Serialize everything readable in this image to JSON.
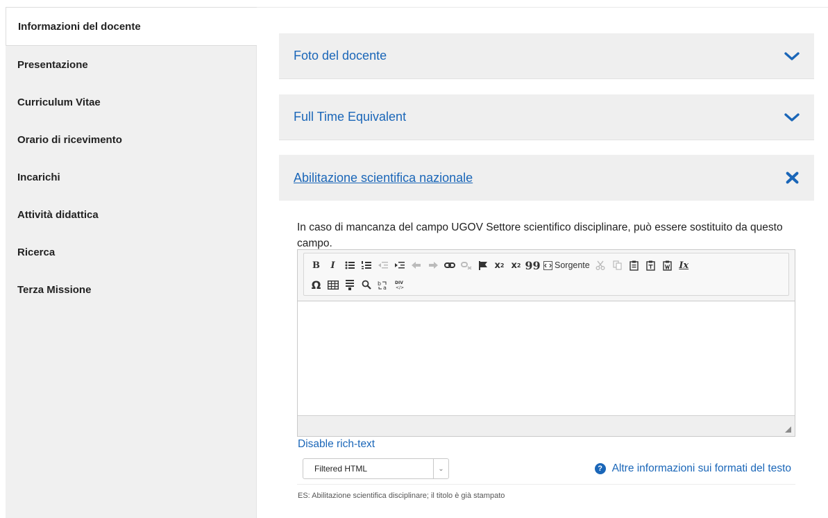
{
  "sidebar": {
    "items": [
      {
        "label": "Informazioni del docente",
        "active": true
      },
      {
        "label": "Presentazione"
      },
      {
        "label": "Curriculum Vitae"
      },
      {
        "label": "Orario di ricevimento"
      },
      {
        "label": "Incarichi"
      },
      {
        "label": "Attività didattica"
      },
      {
        "label": "Ricerca"
      },
      {
        "label": "Terza Missione"
      }
    ]
  },
  "panels": [
    {
      "title": "Foto del docente",
      "state": "collapsed",
      "icon": "chevron-down-icon"
    },
    {
      "title": "Full Time Equivalent",
      "state": "collapsed",
      "icon": "chevron-down-icon"
    },
    {
      "title": "Abilitazione scientifica nazionale",
      "state": "expanded",
      "icon": "close-icon"
    }
  ],
  "editor": {
    "help_text": "In caso di mancanza del campo UGOV Settore scientifico disciplinare, può essere sostituito da questo campo.",
    "toolbar": {
      "bold": "B",
      "italic": "I",
      "source_label": "Sorgente",
      "clear_format": "Ix"
    },
    "content": ""
  },
  "disable_link": "Disable rich-text",
  "format": {
    "selected": "Filtered HTML",
    "help_link": "Altre informazioni sui formati del testo"
  },
  "description": "ES: Abilitazione scientifica disciplinare; il titolo è già stampato",
  "colors": {
    "link": "#1a66b8",
    "sidebar_bg": "#f0f0f0",
    "panel_header_bg": "#efefef"
  }
}
